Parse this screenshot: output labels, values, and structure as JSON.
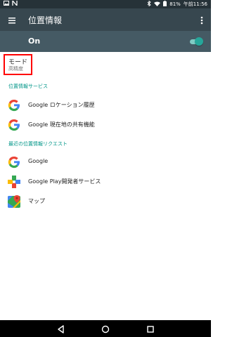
{
  "status_bar": {
    "notification_icons": [
      "image-icon",
      "nfc-icon"
    ],
    "battery": "81%",
    "time": "午前11:56"
  },
  "toolbar": {
    "title": "位置情報",
    "menu_icon": "hamburger-menu-icon",
    "more_icon": "more-vert-icon"
  },
  "master_switch": {
    "label": "On",
    "state": "on",
    "accent_color": "#26a69a"
  },
  "mode": {
    "title": "モード",
    "summary": "高精度",
    "highlight_color": "#ff0000"
  },
  "location_services": {
    "header": "位置情報サービス",
    "items": [
      {
        "label": "Google ロケーション履歴",
        "icon": "google-g-icon"
      },
      {
        "label": "Google 現在地の共有機能",
        "icon": "google-g-icon"
      }
    ]
  },
  "recent_requests": {
    "header": "最近の位置情報リクエスト",
    "items": [
      {
        "label": "Google",
        "icon": "google-g-icon"
      },
      {
        "label": "Google Play開発者サービス",
        "icon": "google-play-services-icon"
      },
      {
        "label": "マップ",
        "icon": "google-maps-icon"
      }
    ]
  },
  "nav_bar": {
    "back_icon": "back-triangle-icon",
    "home_icon": "home-circle-icon",
    "recents_icon": "recents-square-icon"
  }
}
